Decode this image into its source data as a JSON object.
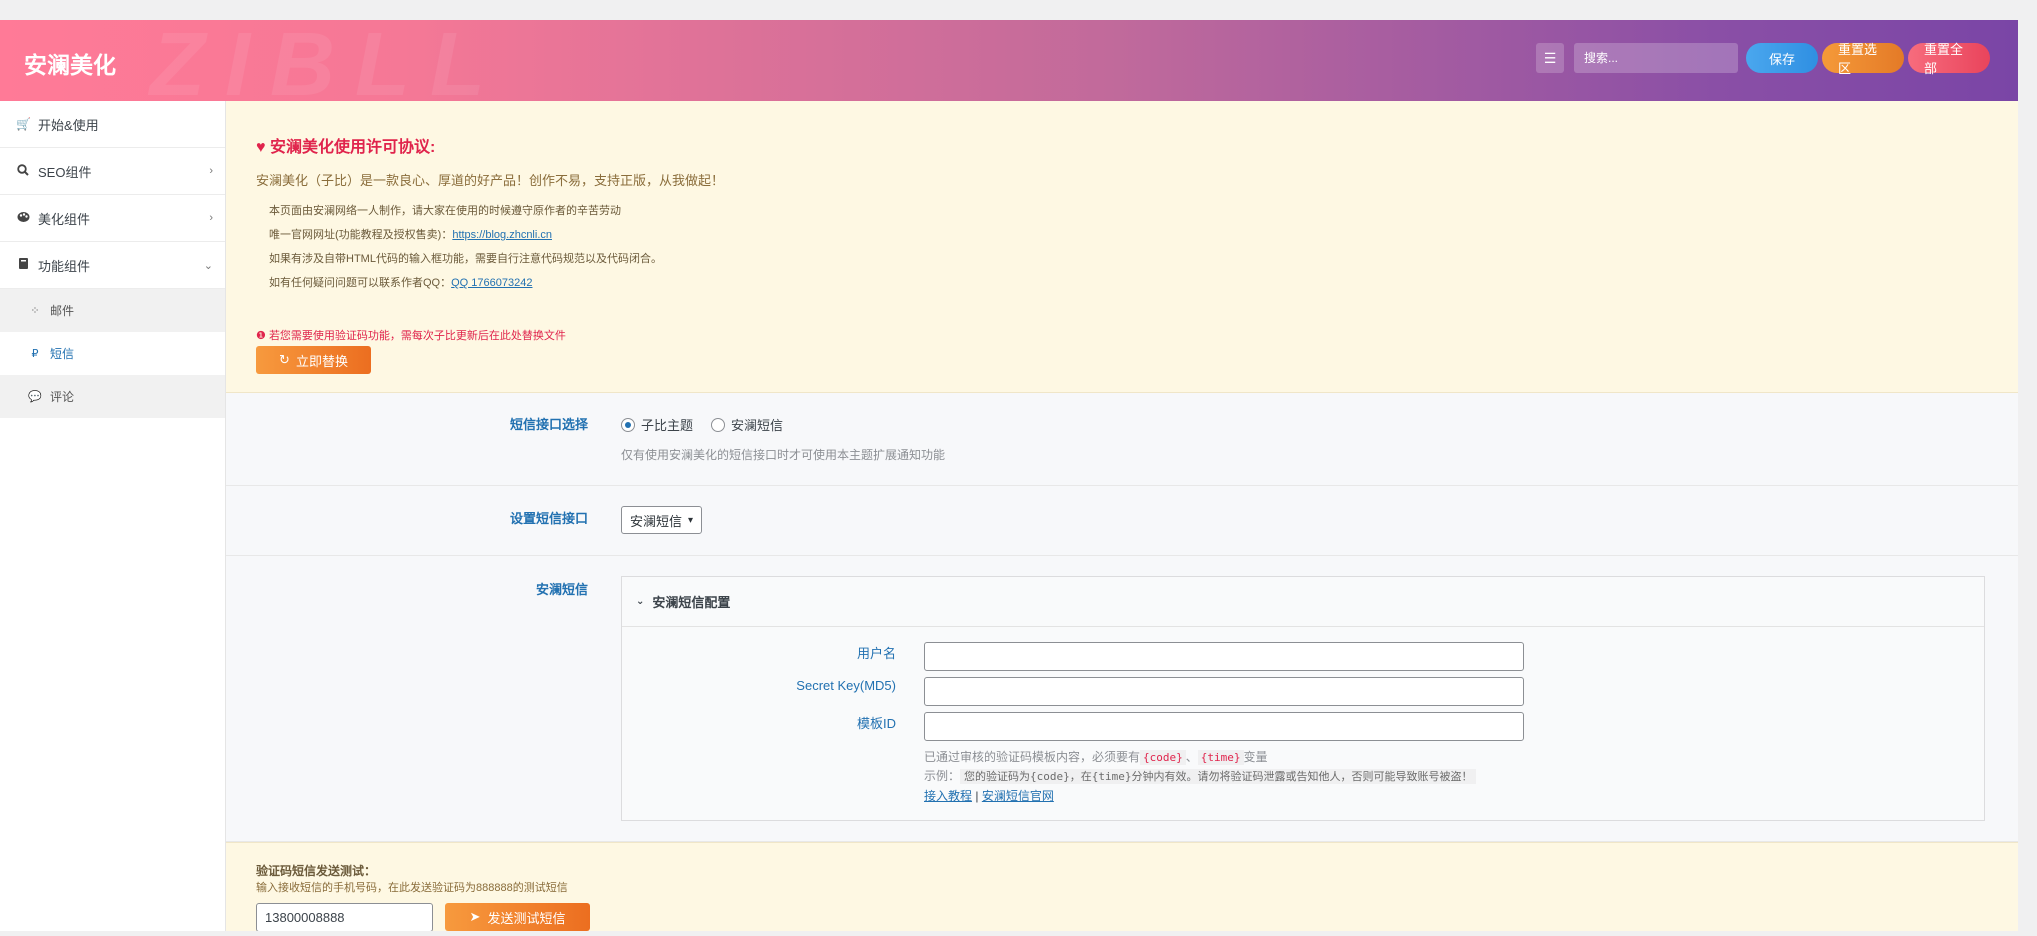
{
  "header": {
    "brand": "安澜美化",
    "watermark": "ZIBLL",
    "search_placeholder": "搜索...",
    "save_label": "保存",
    "reset_section_label": "重置选区",
    "reset_all_label": "重置全部"
  },
  "sidebar": {
    "items": [
      {
        "label": "开始&使用",
        "icon": "cart-icon"
      },
      {
        "label": "SEO组件",
        "icon": "search-icon"
      },
      {
        "label": "美化组件",
        "icon": "palette-icon"
      },
      {
        "label": "功能组件",
        "icon": "book-icon"
      }
    ],
    "sub_items": [
      {
        "label": "邮件",
        "icon": "spinner-icon"
      },
      {
        "label": "短信",
        "icon": "ruble-icon"
      },
      {
        "label": "评论",
        "icon": "comments-icon"
      }
    ]
  },
  "notice": {
    "title": "安澜美化使用许可协议:",
    "intro": "安澜美化（子比）是一款良心、厚道的好产品！创作不易，支持正版，从我做起！",
    "line1": "本页面由安澜网络一人制作，请大家在使用的时候遵守原作者的辛苦劳动",
    "line2_prefix": "唯一官网网址(功能教程及授权售卖)：",
    "line2_link": "https://blog.zhcnli.cn",
    "line3": "如果有涉及自带HTML代码的输入框功能，需要自行注意代码规范以及代码闭合。",
    "line4_prefix": "如有任何疑问问题可以联系作者QQ：",
    "line4_link": "QQ 1766073242",
    "warning": "若您需要使用验证码功能，需每次子比更新后在此处替换文件",
    "replace_button": "立即替换"
  },
  "sms_select": {
    "label": "短信接口选择",
    "options": [
      "子比主题",
      "安澜短信"
    ],
    "selected": "子比主题",
    "desc": "仅有使用安澜美化的短信接口时才可使用本主题扩展通知功能"
  },
  "sms_interface": {
    "label": "设置短信接口",
    "value": "安澜短信"
  },
  "anlan_sms": {
    "label": "安澜短信",
    "panel_title": "安澜短信配置",
    "fields": [
      {
        "label": "用户名",
        "value": ""
      },
      {
        "label": "Secret Key(MD5)",
        "value": ""
      },
      {
        "label": "模板ID",
        "value": ""
      }
    ],
    "hint_prefix": "已通过审核的验证码模板内容，必须要有",
    "hint_code1": "{code}",
    "hint_sep": "、",
    "hint_code2": "{time}",
    "hint_suffix": "变量",
    "example_label": "示例：",
    "example_text": "您的验证码为{code}，在{time}分钟内有效。请勿将验证码泄露或告知他人，否则可能导致账号被盗！",
    "link1": "接入教程",
    "link_sep": "|",
    "link2": "安澜短信官网"
  },
  "test": {
    "title": "验证码短信发送测试：",
    "desc": "输入接收短信的手机号码，在此发送验证码为888888的测试短信",
    "phone_value": "13800008888",
    "send_button": "发送测试短信"
  }
}
